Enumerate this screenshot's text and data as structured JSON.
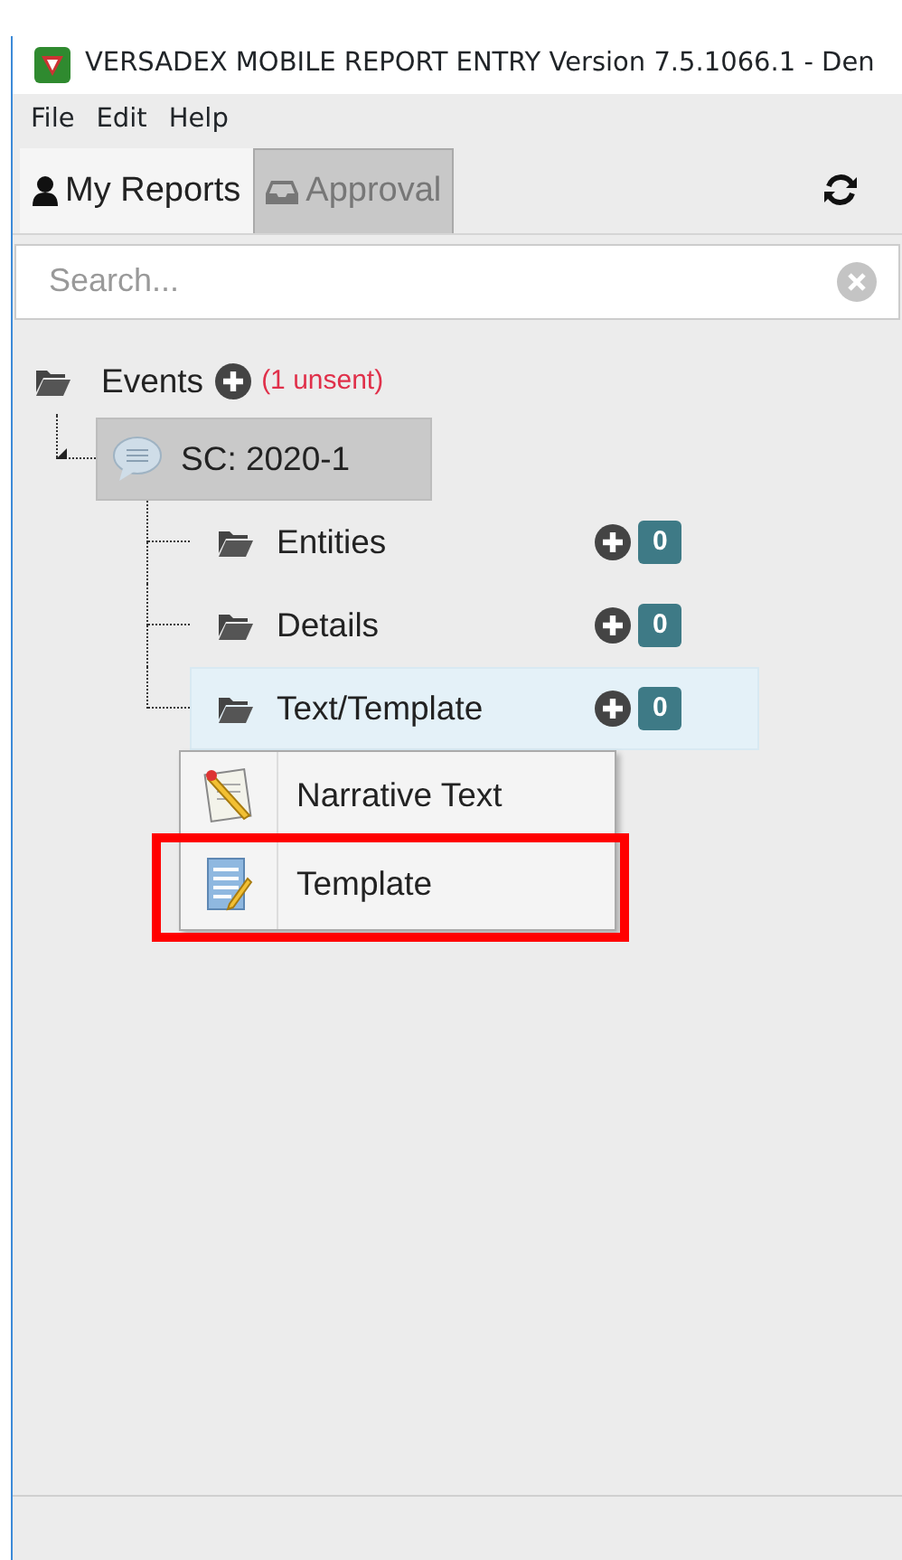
{
  "window": {
    "title": "VERSADEX MOBILE REPORT ENTRY Version 7.5.1066.1 - Den"
  },
  "menu": [
    "File",
    "Edit",
    "Help"
  ],
  "tabs": [
    {
      "label": "My Reports",
      "kind": "user",
      "selected": true
    },
    {
      "label": "Approval",
      "kind": "inbox",
      "selected": false
    }
  ],
  "search": {
    "placeholder": "Search..."
  },
  "tree": {
    "label": "Events",
    "note": "(1 unsent)",
    "expanded": true,
    "children": [
      {
        "label": "SC: 2020-1",
        "expanded": true,
        "children": [
          {
            "label": "Entities",
            "count": "0",
            "selected": false
          },
          {
            "label": "Details",
            "count": "0",
            "selected": false
          },
          {
            "label": "Text/Template",
            "count": "0",
            "selected": true
          }
        ]
      }
    ]
  },
  "context_menu": {
    "items": [
      {
        "label": "Narrative Text",
        "kind": "narrative",
        "highlighted": false
      },
      {
        "label": "Template",
        "kind": "template",
        "highlighted": true
      }
    ]
  }
}
